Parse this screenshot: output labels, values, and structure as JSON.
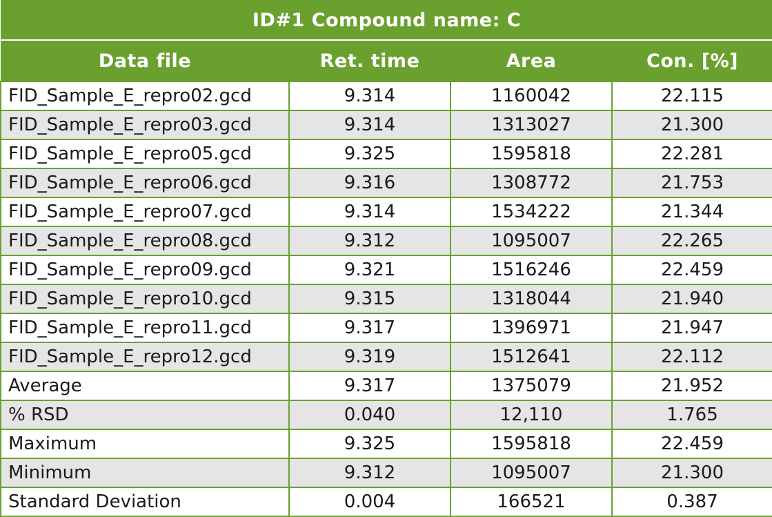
{
  "table": {
    "title": "ID#1 Compound name: C",
    "columns": [
      "Data file",
      "Ret. time",
      "Area",
      "Con. [%]"
    ],
    "rows": [
      [
        "FID_Sample_E_repro02.gcd",
        "9.314",
        "1160042",
        "22.115"
      ],
      [
        "FID_Sample_E_repro03.gcd",
        "9.314",
        "1313027",
        "21.300"
      ],
      [
        "FID_Sample_E_repro05.gcd",
        "9.325",
        "1595818",
        "22.281"
      ],
      [
        "FID_Sample_E_repro06.gcd",
        "9.316",
        "1308772",
        "21.753"
      ],
      [
        "FID_Sample_E_repro07.gcd",
        "9.314",
        "1534222",
        "21.344"
      ],
      [
        "FID_Sample_E_repro08.gcd",
        "9.312",
        "1095007",
        "22.265"
      ],
      [
        "FID_Sample_E_repro09.gcd",
        "9.321",
        "1516246",
        "22.459"
      ],
      [
        "FID_Sample_E_repro10.gcd",
        "9.315",
        "1318044",
        "21.940"
      ],
      [
        "FID_Sample_E_repro11.gcd",
        "9.317",
        "1396971",
        "21.947"
      ],
      [
        "FID_Sample_E_repro12.gcd",
        "9.319",
        "1512641",
        "22.112"
      ]
    ],
    "summary": [
      [
        "Average",
        "9.317",
        "1375079",
        "21.952"
      ],
      [
        "% RSD",
        "0.040",
        "12,110",
        "1.765"
      ],
      [
        "Maximum",
        "9.325",
        "1595818",
        "22.459"
      ],
      [
        "Minimum",
        "9.312",
        "1095007",
        "21.300"
      ],
      [
        "Standard Deviation",
        "0.004",
        "166521",
        "0.387"
      ]
    ]
  },
  "colors": {
    "header_green": "#6aa12e",
    "alt_row_gray": "#e5e5e5"
  }
}
